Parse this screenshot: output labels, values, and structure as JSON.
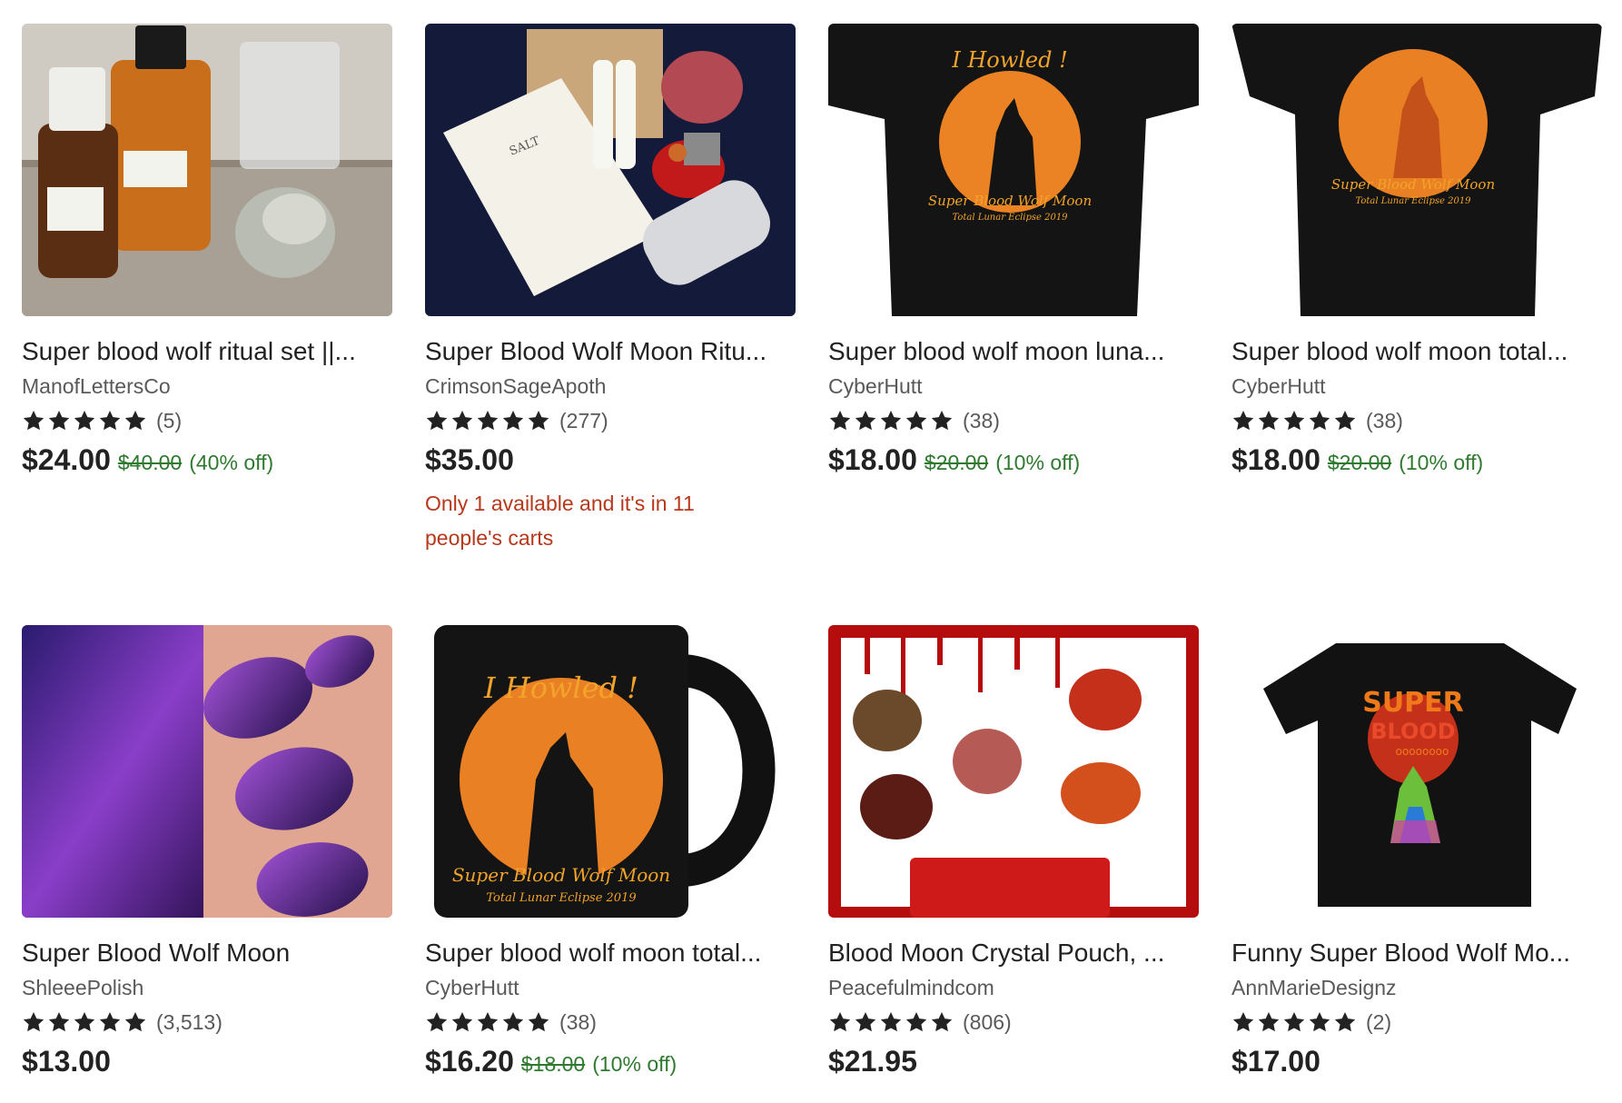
{
  "listings": [
    {
      "title": "Super blood wolf ritual set ||...",
      "shop": "ManofLettersCo",
      "rating": 5,
      "reviews": "(5)",
      "price": "$24.00",
      "original_price": "$40.00",
      "discount": "(40% off)",
      "scarcity": ""
    },
    {
      "title": "Super Blood Wolf Moon Ritu...",
      "shop": "CrimsonSageApoth",
      "rating": 5,
      "reviews": "(277)",
      "price": "$35.00",
      "original_price": "",
      "discount": "",
      "scarcity": "Only 1 available and it's in 11 people's carts"
    },
    {
      "title": "Super blood wolf moon luna...",
      "shop": "CyberHutt",
      "rating": 5,
      "reviews": "(38)",
      "price": "$18.00",
      "original_price": "$20.00",
      "discount": "(10% off)",
      "scarcity": ""
    },
    {
      "title": "Super blood wolf moon total...",
      "shop": "CyberHutt",
      "rating": 5,
      "reviews": "(38)",
      "price": "$18.00",
      "original_price": "$20.00",
      "discount": "(10% off)",
      "scarcity": ""
    },
    {
      "title": "Super Blood Wolf Moon",
      "shop": "ShleeePolish",
      "rating": 5,
      "reviews": "(3,513)",
      "price": "$13.00",
      "original_price": "",
      "discount": "",
      "scarcity": ""
    },
    {
      "title": "Super blood wolf moon total...",
      "shop": "CyberHutt",
      "rating": 5,
      "reviews": "(38)",
      "price": "$16.20",
      "original_price": "$18.00",
      "discount": "(10% off)",
      "scarcity": ""
    },
    {
      "title": "Blood Moon Crystal Pouch, ...",
      "shop": "Peacefulmindcom",
      "rating": 5,
      "reviews": "(806)",
      "price": "$21.95",
      "original_price": "",
      "discount": "",
      "scarcity": ""
    },
    {
      "title": "Funny Super Blood Wolf Mo...",
      "shop": "AnnMarieDesignz",
      "rating": 5,
      "reviews": "(2)",
      "price": "$17.00",
      "original_price": "",
      "discount": "",
      "scarcity": ""
    }
  ],
  "image_text": {
    "salt_label": "SALT",
    "howled": "I Howled !",
    "moon_line": "Super Blood Wolf Moon",
    "eclipse_line": "Total Lunar Eclipse 2019",
    "funny_super": "SUPER",
    "funny_blood": "BLOOD",
    "funny_ooo": "oooooooo"
  },
  "colors": {
    "discount_green": "#2f7a2f",
    "scarcity_red": "#b7381a",
    "star": "#222222",
    "moon_orange": "#e8731a"
  },
  "icons": {
    "star": "star-icon"
  }
}
